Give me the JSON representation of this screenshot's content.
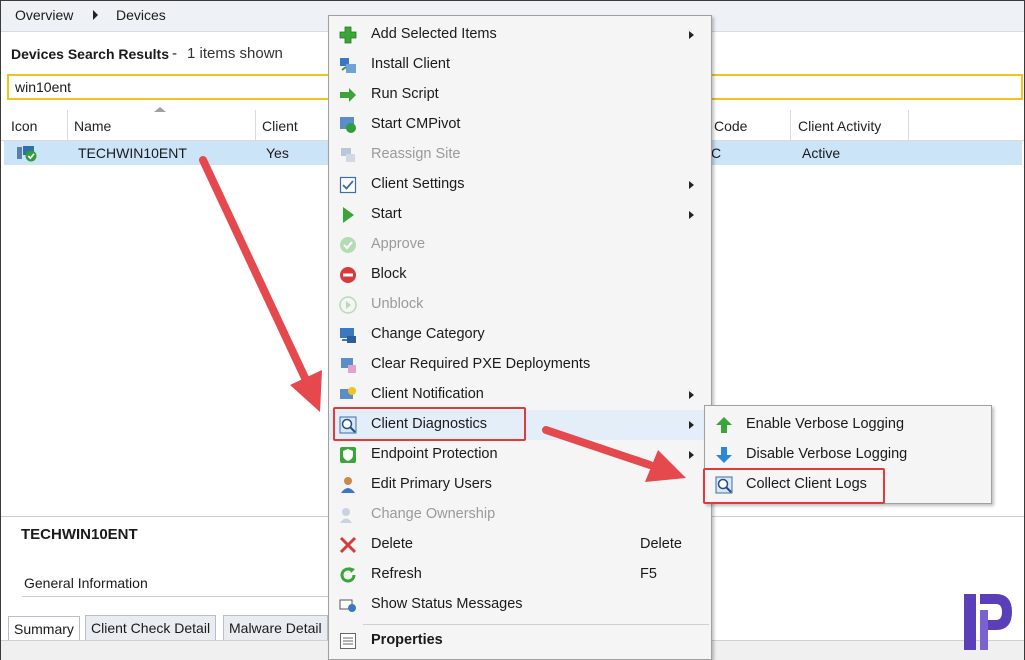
{
  "breadcrumb": {
    "items": [
      "Overview",
      "Devices"
    ]
  },
  "results": {
    "title": "Devices Search Results",
    "separator": "-",
    "count_text": "1 items shown"
  },
  "search": {
    "value": "win10ent"
  },
  "grid": {
    "columns": [
      "Icon",
      "Name",
      "Client",
      "Code",
      "Client Activity"
    ],
    "rows": [
      {
        "name": "TECHWIN10ENT",
        "client": "Yes",
        "code_partial": "C",
        "activity": "Active"
      }
    ]
  },
  "details": {
    "title": "TECHWIN10ENT",
    "section": "General Information",
    "tabs": [
      "Summary",
      "Client Check Detail",
      "Malware Detail"
    ]
  },
  "context_menu": {
    "items": [
      {
        "label": "Add Selected Items",
        "icon": "add-plus-icon",
        "submenu": true
      },
      {
        "label": "Install Client",
        "icon": "install-client-icon"
      },
      {
        "label": "Run Script",
        "icon": "run-script-arrow-icon"
      },
      {
        "label": "Start CMPivot",
        "icon": "cmpivot-icon"
      },
      {
        "label": "Reassign Site",
        "icon": "reassign-site-icon",
        "disabled": true
      },
      {
        "label": "Client Settings",
        "icon": "client-settings-icon",
        "submenu": true
      },
      {
        "label": "Start",
        "icon": "start-play-icon",
        "submenu": true
      },
      {
        "label": "Approve",
        "icon": "approve-check-icon",
        "disabled": true
      },
      {
        "label": "Block",
        "icon": "block-icon"
      },
      {
        "label": "Unblock",
        "icon": "unblock-icon",
        "disabled": true
      },
      {
        "label": "Change Category",
        "icon": "change-category-icon"
      },
      {
        "label": "Clear Required PXE Deployments",
        "icon": "pxe-icon"
      },
      {
        "label": "Client Notification",
        "icon": "client-notification-icon",
        "submenu": true
      },
      {
        "label": "Client Diagnostics",
        "icon": "client-diagnostics-icon",
        "submenu": true
      },
      {
        "label": "Endpoint Protection",
        "icon": "endpoint-protection-icon",
        "submenu": true
      },
      {
        "label": "Edit Primary Users",
        "icon": "primary-users-icon"
      },
      {
        "label": "Change Ownership",
        "icon": "change-ownership-icon",
        "disabled": true
      },
      {
        "label": "Delete",
        "icon": "delete-x-icon",
        "shortcut": "Delete"
      },
      {
        "label": "Refresh",
        "icon": "refresh-icon",
        "shortcut": "F5"
      },
      {
        "label": "Show Status Messages",
        "icon": "status-messages-icon"
      },
      {
        "label": "Properties",
        "icon": "properties-icon",
        "bold": true
      }
    ]
  },
  "submenu": {
    "items": [
      {
        "label": "Enable Verbose Logging",
        "icon": "up-arrow-icon"
      },
      {
        "label": "Disable Verbose Logging",
        "icon": "down-arrow-icon"
      },
      {
        "label": "Collect Client Logs",
        "icon": "collect-logs-icon"
      }
    ]
  },
  "colors": {
    "highlight": "#e03a3a",
    "selection": "#cce4f7",
    "search_border": "#f0c419"
  }
}
